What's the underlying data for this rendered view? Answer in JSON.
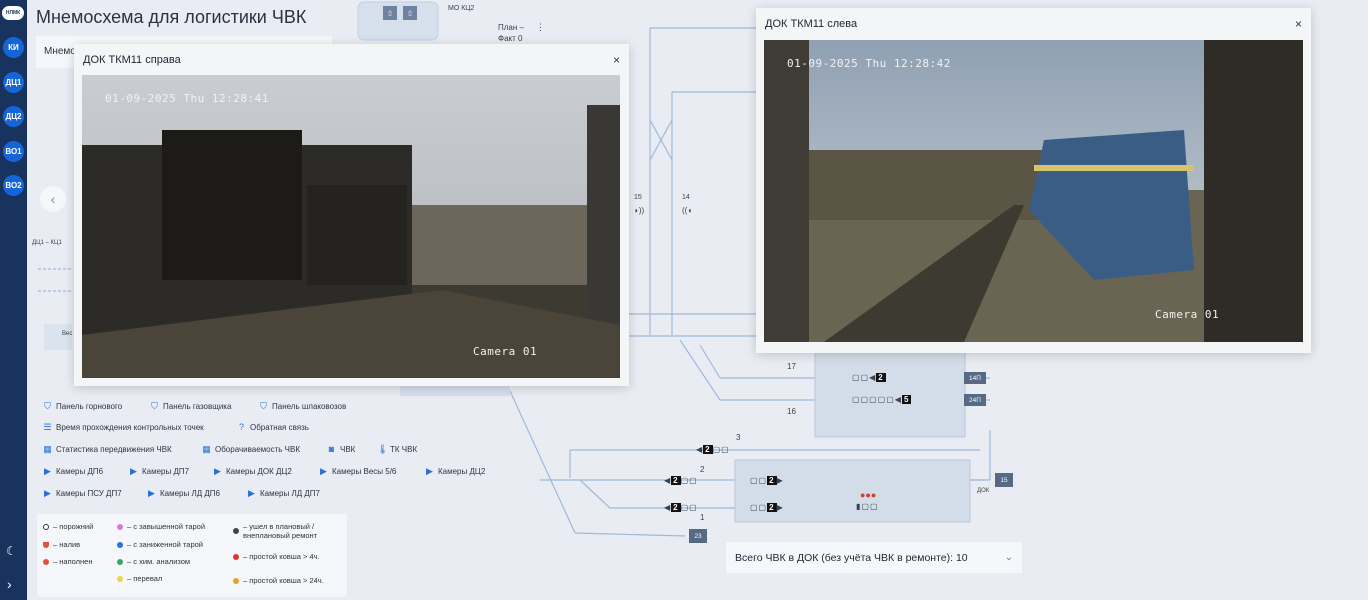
{
  "app": {
    "logo": "НЛМК",
    "title": "Мнемосхема для логистики ЧВК"
  },
  "rail": {
    "items": [
      "КИ",
      "ДЦ1",
      "ДЦ2",
      "ВО1",
      "ВО2"
    ]
  },
  "top": {
    "mo_label": "МО КЦ2",
    "plan_label": "План –",
    "fact_label": "Факт 0",
    "more": "⋮"
  },
  "behind_card": {
    "label": "Мнемо",
    "dc_label": "ДЦ1 – КЦ1",
    "ves_label": "Вес"
  },
  "panels": {
    "right": {
      "title": "ДОК ТКМ11 справа",
      "timestamp": "01-09-2025 Thu 12:28:41",
      "camera": "Camera 01",
      "close": "×"
    },
    "left": {
      "title": "ДОК ТКМ11 слева",
      "timestamp": "01-09-2025 Thu 12:28:42",
      "camera": "Camera 01",
      "close": "×"
    }
  },
  "legend": {
    "links": [
      {
        "label": "Панель горнового",
        "icon": "panel-icon"
      },
      {
        "label": "Панель газовщика",
        "icon": "panel-icon"
      },
      {
        "label": "Панель шлаковозов",
        "icon": "panel-icon"
      },
      {
        "label": "Время прохождения контрольных точек",
        "icon": "list-icon"
      },
      {
        "label": "Обратная связь",
        "icon": "help-icon"
      },
      {
        "label": "Статистика передвижения ЧВК",
        "icon": "table-icon"
      },
      {
        "label": "Оборачиваемость ЧВК",
        "icon": "table-icon"
      },
      {
        "label": "ЧВК",
        "icon": "ladle-icon"
      },
      {
        "label": "ТК ЧВК",
        "icon": "thermometer-icon"
      },
      {
        "label": "Камеры ДП6",
        "icon": "camera-icon"
      },
      {
        "label": "Камеры ДП7",
        "icon": "camera-icon"
      },
      {
        "label": "Камеры ДОК ДЦ2",
        "icon": "camera-icon"
      },
      {
        "label": "Камеры Весы 5/6",
        "icon": "camera-icon"
      },
      {
        "label": "Камеры ДЦ2",
        "icon": "camera-icon"
      },
      {
        "label": "Камеры ПСУ ДП7",
        "icon": "camera-icon"
      },
      {
        "label": "Камеры ЛД ДП6",
        "icon": "camera-icon"
      },
      {
        "label": "Камеры ЛД ДП7",
        "icon": "camera-icon"
      }
    ],
    "keys": [
      {
        "label": "– порожний",
        "color": "#ffffff"
      },
      {
        "label": "– налив",
        "color": "#e0533a"
      },
      {
        "label": "– наполнен",
        "color": "#e0533a"
      },
      {
        "label": "– с завышенной тарой",
        "color": "#d77ad6"
      },
      {
        "label": "– с заниженной тарой",
        "color": "#2f6fe0"
      },
      {
        "label": "– с хим. анализом",
        "color": "#3aa56a"
      },
      {
        "label": "– перевал",
        "color": "#f2d24a"
      },
      {
        "label": "– ушел в плановый / внеплановый ремонт",
        "color": "#444444"
      },
      {
        "label": "– простой ковша > 4ч.",
        "color": "#d93a2b"
      },
      {
        "label": "– простой ковша > 24ч.",
        "color": "#e8a02a"
      }
    ]
  },
  "schema": {
    "tracks": [
      "15",
      "14",
      "17",
      "16",
      "3",
      "2",
      "1"
    ],
    "badges": [
      "14П",
      "24П",
      "15",
      "23"
    ],
    "counts": [
      "2",
      "5",
      "2",
      "2",
      "2",
      "2",
      "2",
      "2",
      "2"
    ],
    "dok_label": "ДОК"
  },
  "totals": {
    "label": "Всего ЧВК в ДОК (без учёта ЧВК в ремонте): 10"
  },
  "colors": {
    "rail": "#18345e",
    "accent": "#1565d8",
    "track": "#9fb8dc"
  }
}
